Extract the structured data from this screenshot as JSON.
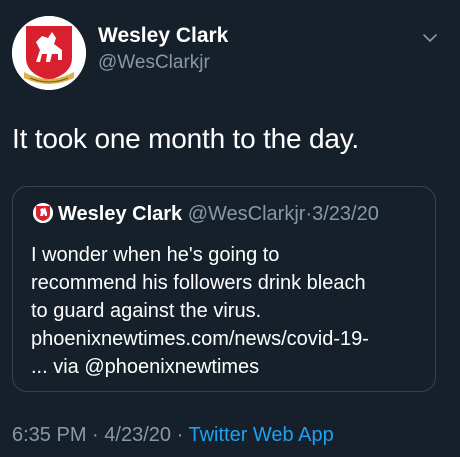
{
  "author": {
    "name": "Wesley Clark",
    "handle": "@WesClarkjr"
  },
  "tweet": {
    "text": "It took one month to the day."
  },
  "quoted_tweet": {
    "name": "Wesley Clark",
    "handle": "@WesClarkjr",
    "separator": "·",
    "date": "3/23/20",
    "lines": [
      "I wonder when he's going to",
      "recommend his followers drink bleach",
      "to guard against the virus.",
      "phoenixnewtimes.com/news/covid-19-",
      "... via @phoenixnewtimes"
    ]
  },
  "meta": {
    "time": "6:35 PM",
    "separator": "·",
    "date": "4/23/20",
    "source": "Twitter Web App"
  },
  "colors": {
    "background": "#15202b",
    "secondary_text": "#8899a6",
    "link": "#1da1f2",
    "border": "#38444d",
    "avatar_red": "#d8202e"
  },
  "icons": {
    "avatar": "white-horse-crest",
    "menu": "chevron-down-icon"
  }
}
